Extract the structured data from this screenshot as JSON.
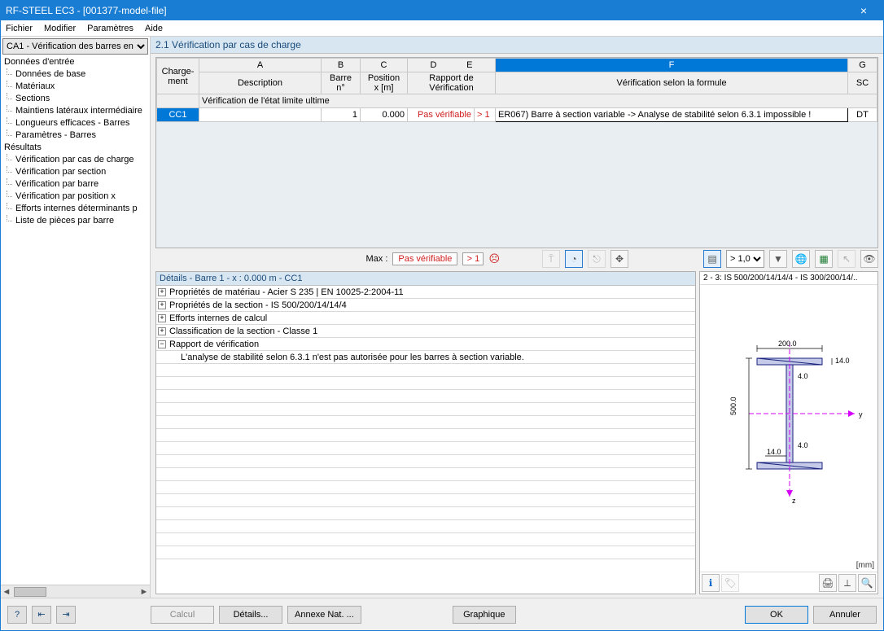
{
  "window": {
    "title": "RF-STEEL EC3 - [001377-model-file]"
  },
  "menu": {
    "file": "Fichier",
    "edit": "Modifier",
    "settings": "Paramètres",
    "help": "Aide"
  },
  "sidebar": {
    "selector": "CA1 - Vérification des barres en",
    "groups": {
      "input_header": "Données d'entrée",
      "input_items": [
        "Données de base",
        "Matériaux",
        "Sections",
        "Maintiens latéraux intermédiaire",
        "Longueurs efficaces - Barres",
        "Paramètres - Barres"
      ],
      "results_header": "Résultats",
      "results_items": [
        "Vérification par cas de charge",
        "Vérification par section",
        "Vérification par barre",
        "Vérification par position x",
        "Efforts internes déterminants p",
        "Liste de pièces par barre"
      ]
    }
  },
  "section": {
    "title": "2.1 Vérification par cas de charge"
  },
  "grid": {
    "colLetters": [
      "A",
      "B",
      "C",
      "D",
      "E",
      "F",
      "G"
    ],
    "headers": {
      "rowhdr1": "Charge-",
      "rowhdr2": "ment",
      "A": "Description",
      "B1": "Barre",
      "B2": "n°",
      "C1": "Position",
      "C2": "x [m]",
      "D1": "Rapport de",
      "D2": "Vérification",
      "F": "Vérification selon la formule",
      "G": "SC"
    },
    "groupRow": "Vérification de l'état limite ultime",
    "row": {
      "cc": "CC1",
      "desc": "",
      "barre": "1",
      "pos": "0.000",
      "rapport": "Pas vérifiable",
      "ratio": "> 1",
      "formula": "ER067) Barre à section variable -> Analyse de stabilité selon 6.3.1 impossible !",
      "sc": "DT"
    }
  },
  "maxbar": {
    "label": "Max :",
    "val": "Pas vérifiable",
    "ratio": "> 1",
    "combo": "> 1,0"
  },
  "details": {
    "header": "Détails - Barre 1 - x : 0.000 m - CC1",
    "rows": [
      {
        "exp": "+",
        "text": "Propriétés de matériau - Acier S 235 | EN 10025-2:2004-11"
      },
      {
        "exp": "+",
        "text": "Propriétés de la section  -  IS 500/200/14/14/4"
      },
      {
        "exp": "+",
        "text": "Efforts internes de calcul"
      },
      {
        "exp": "+",
        "text": "Classification de la section - Classe 1"
      },
      {
        "exp": "-",
        "text": "Rapport de vérification"
      },
      {
        "exp": "",
        "indent": true,
        "text": "L'analyse de stabilité selon 6.3.1 n'est pas autorisée pour les barres à section variable."
      }
    ]
  },
  "preview": {
    "header": "2 - 3: IS 500/200/14/14/4 - IS 300/200/14/..",
    "dims": {
      "bf": "200.0",
      "tf": "14.0",
      "tw": "4.0",
      "tw2": "4.0",
      "h": "500.0",
      "tf2": "14.0"
    },
    "unit": "[mm]"
  },
  "footer": {
    "calc": "Calcul",
    "details": "Détails...",
    "annex": "Annexe Nat. ...",
    "graph": "Graphique",
    "ok": "OK",
    "cancel": "Annuler"
  }
}
